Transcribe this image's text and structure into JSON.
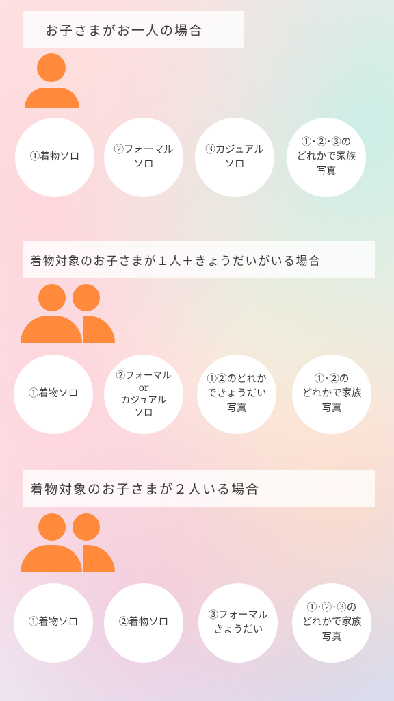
{
  "sections": [
    {
      "title": "お子さまがお一人の場合",
      "icon": "single-person-icon",
      "options": [
        "①着物ソロ",
        "②フォーマル\nソロ",
        "③カジュアル\nソロ",
        "①･②･③の\nどれかで家族\n写真"
      ]
    },
    {
      "title": "着物対象のお子さまが１人＋きょうだいがいる場合",
      "icon": "two-people-icon",
      "options": [
        "①着物ソロ",
        "②フォーマル\nor\nカジュアル\nソロ",
        "①②のどれか\nできょうだい\n写真",
        "①･②の\nどれかで家族\n写真"
      ]
    },
    {
      "title": "着物対象のお子さまが２人いる場合",
      "icon": "two-people-icon",
      "options": [
        "①着物ソロ",
        "②着物ソロ",
        "③フォーマル\nきょうだい",
        "①･②･③の\nどれかで家族\n写真"
      ]
    }
  ],
  "colors": {
    "accent": "#ff8a3c",
    "banner": "#ffffff",
    "text": "#3a3a3a"
  }
}
